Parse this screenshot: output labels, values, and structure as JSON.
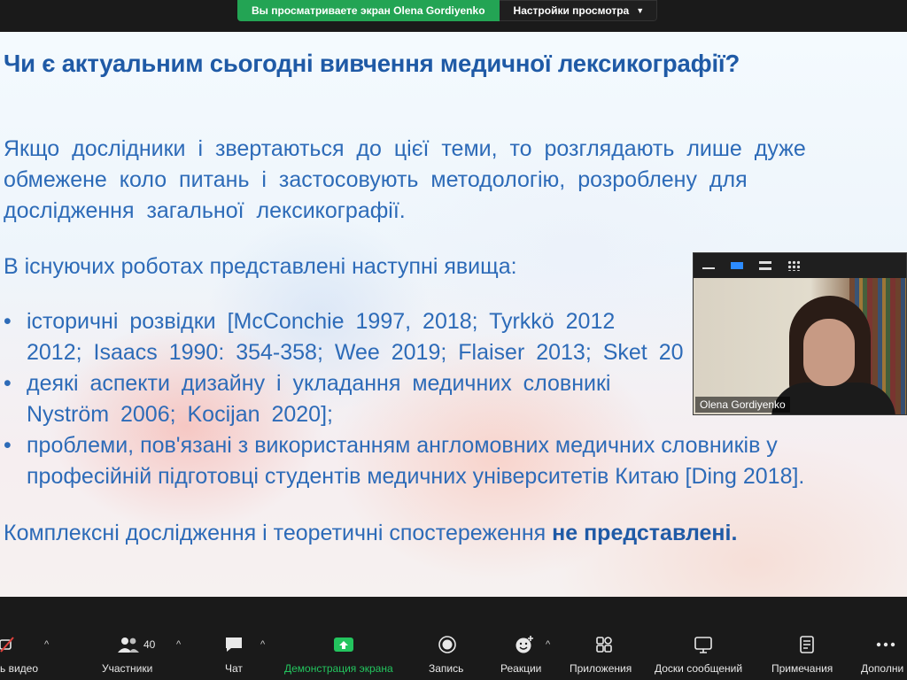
{
  "share_bar": {
    "status": "Вы просматриваете экран Olena Gordiyenko",
    "options_label": "Настройки просмотра"
  },
  "slide": {
    "title": "Чи є актуальним сьогодні вивчення медичної лексикографії?",
    "para1": [
      "Якщо дослідники і звертаються до цієї теми, то розглядають лише дуже",
      "обмежене коло питань і застосовують методологію, розроблену для",
      "дослідження загальної лексикографії."
    ],
    "para2": "В існуючих роботах представлені наступні явища:",
    "bullets": [
      [
        "історичні розвідки [McConchie 1997, 2018; Tyrkkö 2012",
        "2012; Isaacs 1990: 354-358; Wee 2019; Flaiser 2013; Sket 20"
      ],
      [
        "деякі аспекти дизайну і укладання медичних словникі",
        "Nyström 2006; Kocijan 2020];"
      ],
      [
        "проблеми, пов'язані з використанням англомовних медичних словників у",
        "професійній підготовці студентів медичних університетів Китаю [Ding 2018]."
      ]
    ],
    "conclusion_normal": "Комплексні дослідження і теоретичні спостереження ",
    "conclusion_bold": "не представлені."
  },
  "video": {
    "participant_name": "Olena Gordiyenko"
  },
  "toolbar": {
    "video_label": "ь видео",
    "participants_label": "Участники",
    "participants_count": "40",
    "chat_label": "Чат",
    "share_label": "Демонстрация экрана",
    "record_label": "Запись",
    "reactions_label": "Реакции",
    "apps_label": "Приложения",
    "whiteboards_label": "Доски сообщений",
    "notes_label": "Примечания",
    "more_label": "Дополни"
  },
  "colors": {
    "share_green": "#23a454",
    "slide_text": "#2d6bb8",
    "title_text": "#1f5aa6",
    "accent_blue": "#2d8cff"
  }
}
